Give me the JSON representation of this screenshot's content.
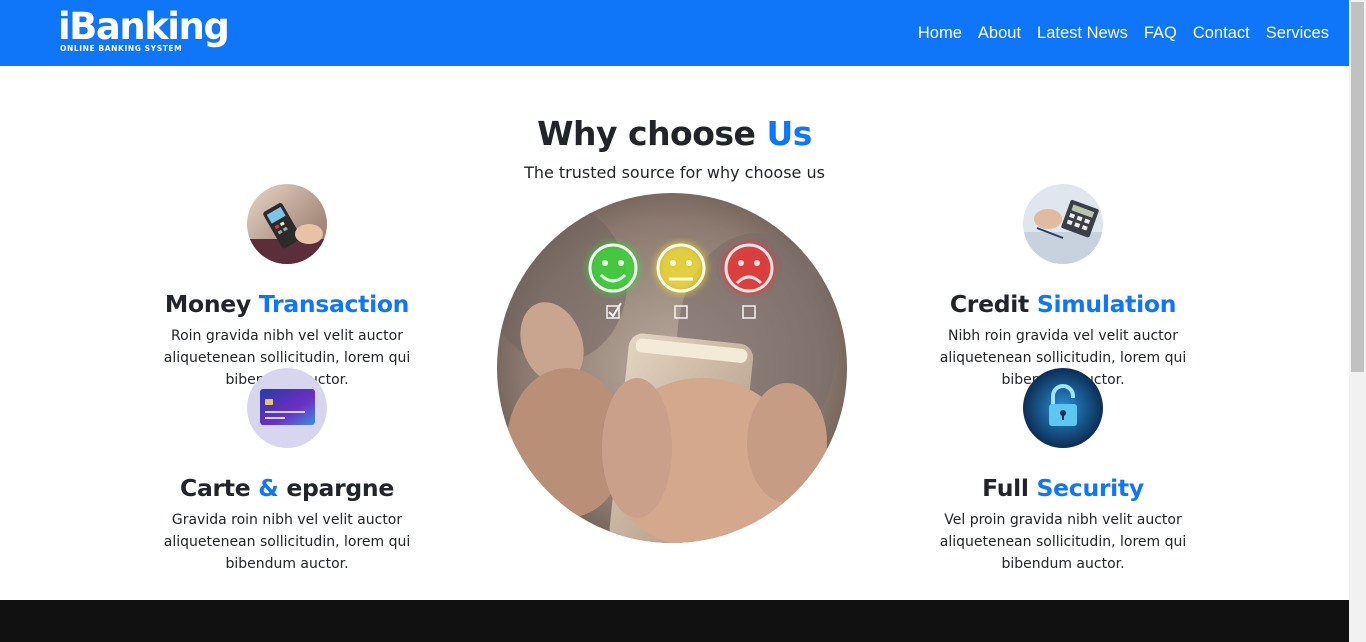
{
  "brand": {
    "name": "iBanking",
    "tagline": "ONLINE BANKING SYSTEM"
  },
  "nav": {
    "items": [
      {
        "label": "Home"
      },
      {
        "label": "About"
      },
      {
        "label": "Latest News"
      },
      {
        "label": "FAQ"
      },
      {
        "label": "Contact"
      },
      {
        "label": "Services"
      }
    ]
  },
  "section": {
    "title_main": "Why choose",
    "title_accent": "Us",
    "subtitle": "The trusted source for why choose us"
  },
  "features": {
    "money": {
      "title_main": "Money",
      "title_accent": "Transaction",
      "text": "Roin gravida nibh vel velit auctor aliquetenean sollicitudin, lorem qui bibendum auctor."
    },
    "carte": {
      "title_main": "Carte",
      "title_accent": "&",
      "title_end": "epargne",
      "text": "Gravida roin nibh vel velit auctor aliquetenean sollicitudin, lorem qui bibendum auctor."
    },
    "credit": {
      "title_main": "Credit",
      "title_accent": "Simulation",
      "text": "Nibh roin gravida vel velit auctor aliquetenean sollicitudin, lorem qui bibendum auctor."
    },
    "security": {
      "title_main": "Full",
      "title_accent": "Security",
      "text": "Vel proin gravida nibh velit auctor aliquetenean sollicitudin, lorem qui bibendum auctor."
    }
  },
  "colors": {
    "primary": "#0f75f9",
    "footer": "#111111",
    "text": "#212529"
  }
}
